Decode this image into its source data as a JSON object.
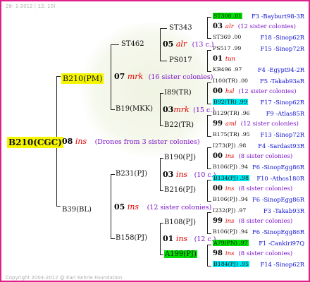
{
  "header": "28- 1-2012 ( 12: 10)",
  "footer": "Copyright 2004-2012 @ Karl Kehrle Foundation.",
  "root": {
    "id": "B210(CGC)",
    "count": "08",
    "breed": "ins",
    "note": "(Drones from 3 sister colonies)"
  },
  "left_top": {
    "id": "B210(PM)",
    "count": "07",
    "breed": "mrk",
    "note": "(16 sister colonies)"
  },
  "left_bottom": {
    "id": "B39(BL)",
    "count": "05",
    "breed": "ins",
    "note": "(12 sister colonies)"
  },
  "ST462": {
    "id": "ST462",
    "count": "05",
    "breed": "alr",
    "note": "(13 c.)"
  },
  "B19": {
    "id": "B19(MKK)",
    "count": "03",
    "breed": "mrk",
    "note": "(15 c.)"
  },
  "B231": {
    "id": "B231(PJ)",
    "count": "03",
    "breed": "ins",
    "note": "(10 c.)"
  },
  "B158": {
    "id": "B158(PJ)",
    "count": "01",
    "breed": "ins",
    "note": "(12 c.)"
  },
  "gp": {
    "ST343": "ST343",
    "PS017": "PS017",
    "I89": "I89(TR)",
    "B22": "B22(TR)",
    "B190": "B190(PJ)",
    "B216": "B216(PJ)",
    "B108": "B108(PJ)",
    "A199": "A199(PJ)"
  },
  "rows": [
    {
      "a": "ST308 .01",
      "b": "F3 -Bayburt98-3R"
    },
    {
      "cnt": "03",
      "br": "alr",
      "note": "(12 sister colonies)"
    },
    {
      "a": "ST369 .00",
      "b": "F18 -Sinop62R"
    },
    {
      "a": "PS517 .99",
      "b": "F15 -Sinop72R"
    },
    {
      "cnt": "01",
      "br": "tun",
      "note": ""
    },
    {
      "a": "KB496 .97",
      "b": "F4 -Egypt94-2R"
    },
    {
      "a": "I100(TR) .00",
      "b": "F5 -Takab93aR"
    },
    {
      "cnt": "00",
      "br": "hsl",
      "note": "(12 sister colonies)"
    },
    {
      "a": "B92(TR) .99",
      "b": "F17 -Sinop62R"
    },
    {
      "a": "B129(TR) .96",
      "b": "F9 -Atlas85R"
    },
    {
      "cnt": "99",
      "br": "aml",
      "note": "(12 sister colonies)"
    },
    {
      "a": "B175(TR) .95",
      "b": "F13 -Sinop72R"
    },
    {
      "a": "I273(PJ) .98",
      "b": "F4 -Sardast93R"
    },
    {
      "cnt": "00",
      "br": "ins",
      "note": "(8 sister colonies)"
    },
    {
      "a": "B106(PJ) .94",
      "b": "F6 -SinopEgg86R"
    },
    {
      "a": "B134(PJ) .98",
      "b": "F10 -Athos180R"
    },
    {
      "cnt": "00",
      "br": "ins",
      "note": "(8 sister colonies)"
    },
    {
      "a": "B106(PJ) .94",
      "b": "F6 -SinopEgg86R"
    },
    {
      "a": "I232(PJ) .97",
      "b": "F3 -Takab93R"
    },
    {
      "cnt": "99",
      "br": "ins",
      "note": "(8 sister colonies)"
    },
    {
      "a": "B106(PJ) .94",
      "b": "F6 -SinopEgg86R"
    },
    {
      "a": "A79(PN) .97",
      "b": "F1 -Cankiri97Q"
    },
    {
      "cnt": "98",
      "br": "ins",
      "note": "(8 sister colonies)"
    },
    {
      "a": "B184(PJ) .95",
      "b": "F14 -Sinop62R"
    }
  ],
  "highlights": {
    "root": "#f5f500",
    "green": "#00e000",
    "cyan": "#00e8f0",
    "border": "#e0208a"
  }
}
